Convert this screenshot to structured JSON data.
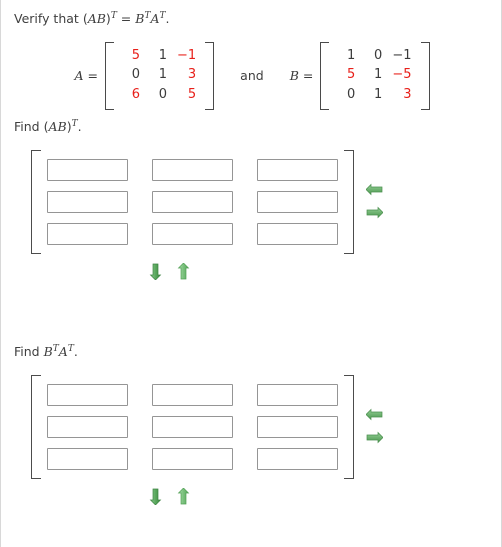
{
  "question": {
    "prompt_prefix": "Verify that (",
    "prompt_text": "Verify that (AB)T = BTAT.",
    "verify_lead": "Verify that",
    "and_word": "and",
    "matrix_a_label": "A =",
    "matrix_b_label": "B ="
  },
  "matrices": {
    "A": {
      "name": "A",
      "rows": [
        [
          {
            "v": "5",
            "color": "red"
          },
          {
            "v": "1",
            "color": "dark"
          },
          {
            "v": "−1",
            "color": "red"
          }
        ],
        [
          {
            "v": "0",
            "color": "dark"
          },
          {
            "v": "1",
            "color": "dark"
          },
          {
            "v": "3",
            "color": "red"
          }
        ],
        [
          {
            "v": "6",
            "color": "red"
          },
          {
            "v": "0",
            "color": "dark"
          },
          {
            "v": "5",
            "color": "red"
          }
        ]
      ]
    },
    "B": {
      "name": "B",
      "rows": [
        [
          {
            "v": "1",
            "color": "dark"
          },
          {
            "v": "0",
            "color": "dark"
          },
          {
            "v": "−1",
            "color": "dark"
          }
        ],
        [
          {
            "v": "5",
            "color": "red"
          },
          {
            "v": "1",
            "color": "dark"
          },
          {
            "v": "−5",
            "color": "red"
          }
        ],
        [
          {
            "v": "0",
            "color": "dark"
          },
          {
            "v": "1",
            "color": "dark"
          },
          {
            "v": "3",
            "color": "red"
          }
        ]
      ]
    }
  },
  "sections": [
    {
      "id": "find-ab-transpose",
      "label_plain": "Find (AB)T.",
      "label_lead": "Find (",
      "label_mid": "AB",
      "label_close": ")",
      "label_exp": "T",
      "label_end": ".",
      "answers": [
        [
          "",
          "",
          ""
        ],
        [
          "",
          "",
          ""
        ],
        [
          "",
          "",
          ""
        ]
      ],
      "placeholder": ""
    },
    {
      "id": "find-bt-at",
      "label_plain": "Find BTAT.",
      "label_lead": "Find ",
      "label_b": "B",
      "label_exp1": "T",
      "label_a": "A",
      "label_exp2": "T",
      "label_end": ".",
      "answers": [
        [
          "",
          "",
          ""
        ],
        [
          "",
          "",
          ""
        ],
        [
          "",
          "",
          ""
        ]
      ],
      "placeholder": ""
    }
  ],
  "controls": {
    "remove_column": "remove-column",
    "add_column": "add-column",
    "remove_row": "remove-row",
    "add_row": "add-row",
    "arrow_color_dark": "#4f9b52",
    "arrow_color_light": "#7cbf7e"
  },
  "colors": {
    "red": "#e8201a",
    "dark": "#3b3b3b",
    "text": "#3f3f3f",
    "box_border": "#959595",
    "bracket": "#4c4c4c"
  }
}
